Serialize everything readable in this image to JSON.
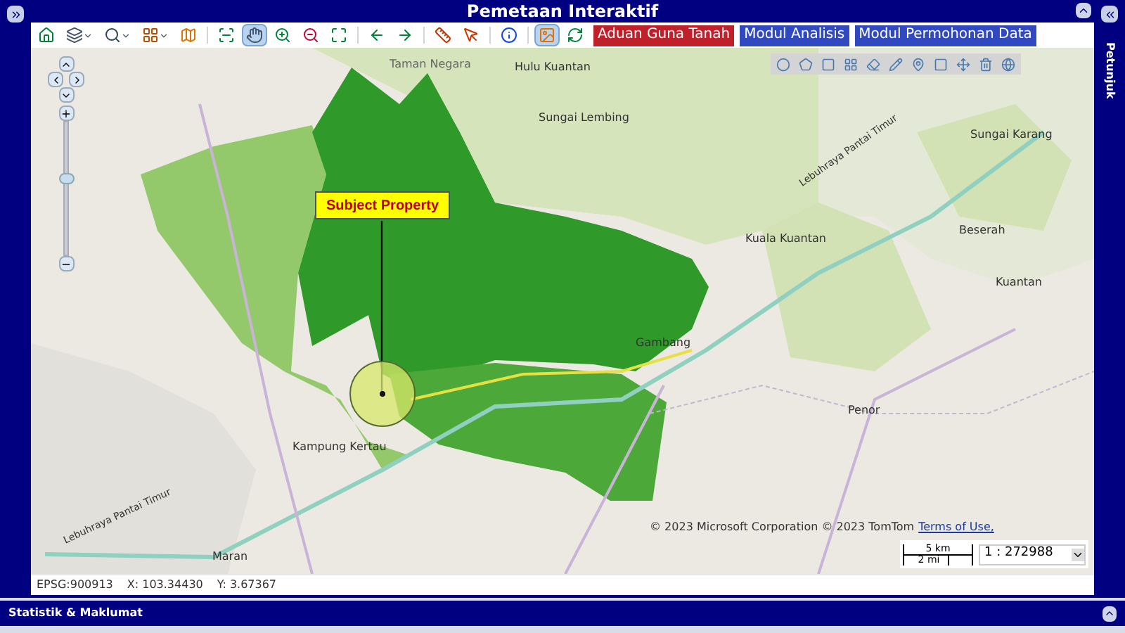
{
  "window": {
    "title": "Pemetaan Interaktif"
  },
  "toolbar": {
    "tool_groups": [
      [
        {
          "kind": "home",
          "selected": false,
          "dropdown": false
        },
        {
          "kind": "layers",
          "selected": false,
          "dropdown": true
        },
        {
          "kind": "zoom",
          "selected": false,
          "dropdown": true
        },
        {
          "kind": "grid",
          "selected": false,
          "dropdown": true
        },
        {
          "kind": "map",
          "selected": false,
          "dropdown": false
        }
      ],
      [
        {
          "kind": "scan",
          "selected": false,
          "dropdown": false
        },
        {
          "kind": "pan",
          "selected": true,
          "dropdown": false
        },
        {
          "kind": "zoom-in",
          "selected": false,
          "dropdown": false
        },
        {
          "kind": "zoom-out",
          "selected": false,
          "dropdown": false
        },
        {
          "kind": "extent",
          "selected": false,
          "dropdown": false
        }
      ],
      [
        {
          "kind": "back",
          "selected": false,
          "dropdown": false
        },
        {
          "kind": "forward",
          "selected": false,
          "dropdown": false
        }
      ],
      [
        {
          "kind": "measure",
          "selected": false,
          "dropdown": false
        },
        {
          "kind": "select",
          "selected": false,
          "dropdown": false
        }
      ],
      [
        {
          "kind": "info",
          "selected": false,
          "dropdown": false
        }
      ],
      [
        {
          "kind": "image",
          "selected": true,
          "dropdown": false
        },
        {
          "kind": "refresh",
          "selected": false,
          "dropdown": false
        }
      ]
    ],
    "modules": [
      {
        "label": "Aduan Guna Tanah",
        "color": "#c0202a"
      },
      {
        "label": "Modul Analisis",
        "color": "#3048c0"
      },
      {
        "label": "Modul Permohonan Data",
        "color": "#3048c0"
      }
    ]
  },
  "map": {
    "zoom": {
      "level": 0.58
    },
    "places": [
      {
        "label": "Taman Negara",
        "kind": "area"
      },
      {
        "label": "Hulu Kuantan",
        "kind": "town"
      },
      {
        "label": "Sungai Lembing",
        "kind": "town"
      },
      {
        "label": "Sungai Karang",
        "kind": "town"
      },
      {
        "label": "Beserah",
        "kind": "town"
      },
      {
        "label": "Kuala Kuantan",
        "kind": "town"
      },
      {
        "label": "Kuantan",
        "kind": "town"
      },
      {
        "label": "Gambang",
        "kind": "town"
      },
      {
        "label": "Penor",
        "kind": "town"
      },
      {
        "label": "Kampung Kertau",
        "kind": "town"
      },
      {
        "label": "Maran",
        "kind": "town"
      },
      {
        "label": "Lebuhraya Pantai Timur",
        "kind": "road"
      },
      {
        "label": "Lebuhraya Pantai Timur",
        "kind": "road"
      }
    ],
    "callout": "Subject Property",
    "copyright": "© 2023 Microsoft Corporation © 2023 TomTom",
    "terms_link": "Terms of Use,",
    "scale": {
      "metric": "5 km",
      "imperial": "2 mi",
      "ratio": "1 : 272988"
    }
  },
  "status_bar": {
    "projection": "EPSG:900913",
    "x": "X: 103.34430",
    "y": "Y: 3.67367"
  },
  "right_panel": {
    "title": "Petunjuk"
  },
  "bottom_panel": {
    "title": "Statistik & Maklumat"
  }
}
